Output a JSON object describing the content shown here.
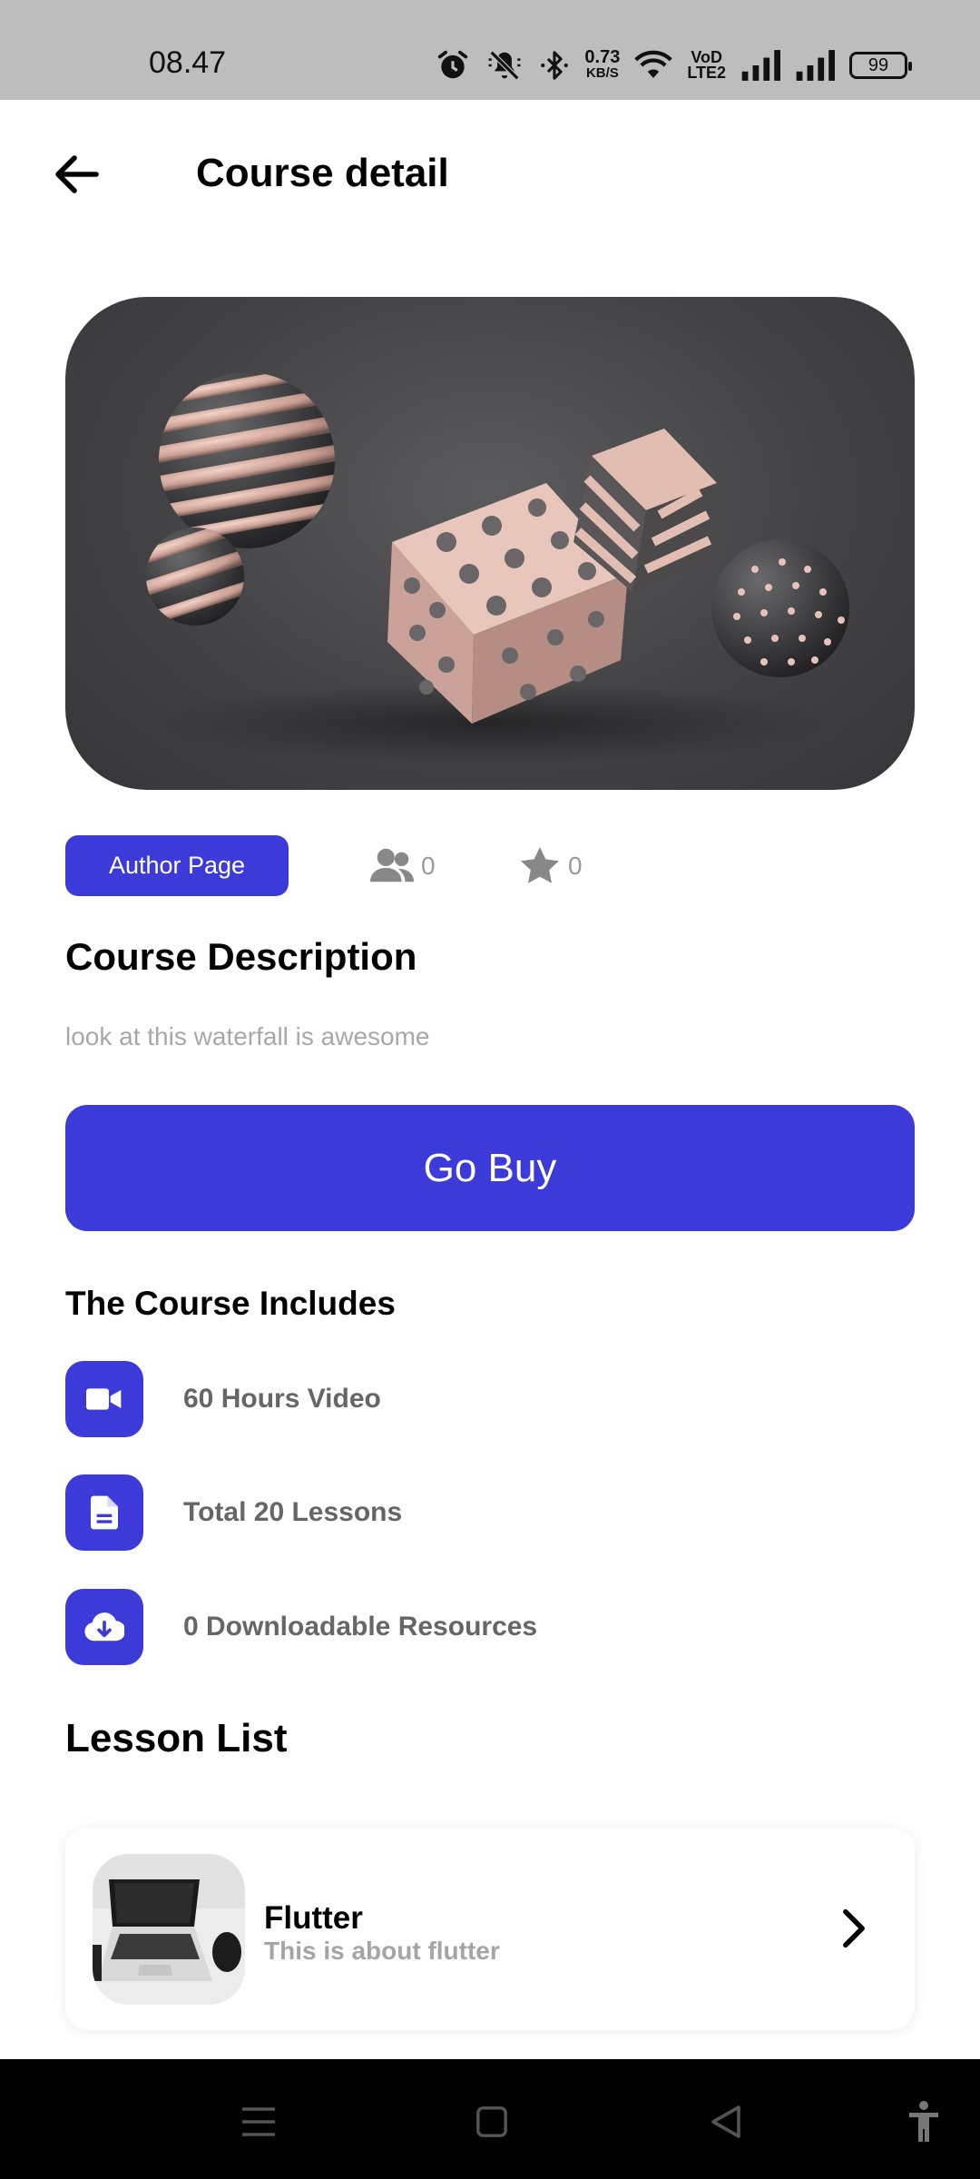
{
  "status_bar": {
    "time": "08.47",
    "net_speed_value": "0.73",
    "net_speed_unit": "KB/S",
    "volte_top": "VoD",
    "volte_bottom": "LTE2",
    "battery": "99",
    "icons": [
      "alarm-icon",
      "mute-icon",
      "bluetooth-icon",
      "wifi-icon",
      "signal-icon",
      "signal-icon",
      "battery-icon"
    ]
  },
  "header": {
    "title": "Course detail",
    "back_icon": "arrow-left-icon"
  },
  "hero": {
    "image": "abstract-3d-shapes"
  },
  "meta": {
    "author_button": "Author Page",
    "students_count": "0",
    "rating": "0",
    "students_icon": "users-icon",
    "rating_icon": "star-icon"
  },
  "description": {
    "heading": "Course Description",
    "text": "look at this waterfall is awesome"
  },
  "buy_button": "Go Buy",
  "includes": {
    "heading": "The Course Includes",
    "items": [
      {
        "icon": "video-camera-icon",
        "label": "60 Hours Video"
      },
      {
        "icon": "document-icon",
        "label": "Total 20 Lessons"
      },
      {
        "icon": "cloud-download-icon",
        "label": "0 Downloadable Resources"
      }
    ]
  },
  "lessons": {
    "heading": "Lesson List",
    "items": [
      {
        "title": "Flutter",
        "subtitle": "This is about flutter",
        "thumb": "laptop-photo"
      }
    ]
  },
  "colors": {
    "accent": "#3c3ad8",
    "status_bar": "#bdbdbd",
    "nav_bar": "#000000",
    "muted_text": "#a8a8a8"
  },
  "nav_bar": {
    "buttons": [
      "menu-icon",
      "home-square-icon",
      "back-triangle-icon",
      "accessibility-icon"
    ]
  }
}
